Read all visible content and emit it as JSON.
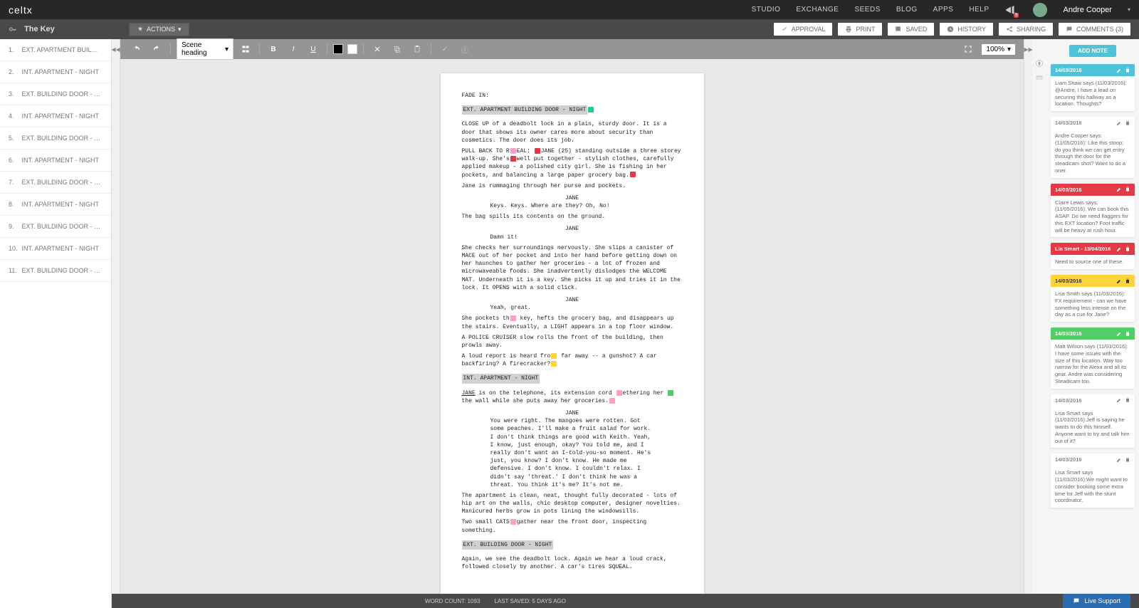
{
  "brand": "celtx",
  "topnav": [
    "STUDIO",
    "EXCHANGE",
    "SEEDS",
    "BLOG",
    "APPS",
    "HELP"
  ],
  "notif_count": "9",
  "user": "Andre Cooper",
  "project_title": "The Key",
  "actions_label": "ACTIONS",
  "subbar_buttons": {
    "approval": "APPROVAL",
    "print": "PRINT",
    "saved": "SAVED",
    "history": "HISTORY",
    "sharing": "SHARING",
    "comments": "COMMENTS (3)"
  },
  "scene_type_value": "Scene heading",
  "zoom_value": "100%",
  "scenes": [
    {
      "n": "1.",
      "t": "EXT. APARTMENT BUILDING DOOR - ..."
    },
    {
      "n": "2.",
      "t": "INT. APARTMENT - NIGHT"
    },
    {
      "n": "3.",
      "t": "EXT. BUILDING DOOR - NIGHT"
    },
    {
      "n": "4.",
      "t": "INT. APARTMENT - NIGHT"
    },
    {
      "n": "5.",
      "t": "EXT. BUILDING DOOR - NIGHT"
    },
    {
      "n": "6.",
      "t": "INT. APARTMENT - NIGHT"
    },
    {
      "n": "7.",
      "t": "EXT. BUILDING DOOR - NIGHT"
    },
    {
      "n": "8.",
      "t": "INT. APARTMENT - NIGHT"
    },
    {
      "n": "9.",
      "t": "EXT. BUILDING DOOR - NIGHT"
    },
    {
      "n": "10.",
      "t": "INT. APARTMENT - NIGHT"
    },
    {
      "n": "11.",
      "t": "EXT. BUILDING DOOR - NIGHT"
    }
  ],
  "script": {
    "fade_in": "FADE IN:",
    "sh1": "EXT. APARTMENT BUILDING DOOR - NIGHT",
    "a1": "CLOSE UP of a deadbolt lock in a plain, sturdy door. It is a door that shows its owner cares more about security than cosmetics. The door does its job.",
    "a2a": "PULL BACK TO R",
    "a2b": "EAL: ",
    "a2c": "JANE",
    "a2d": " (25) standing outside a three storey walk-up. She's",
    "a2e": "well put together - stylish clothes, carefully applied makeup - a polished city girl. She is fish",
    "a2f": "ing",
    "a2g": " in her pockets, and balancing a large paper grocery bag.",
    "a3": "Jane is rummaging through her purse and pockets.",
    "c1": "JANE",
    "d1": "Keys. Keys. Where are they? Oh, No!",
    "a4": "The bag spills its contents on the ground.",
    "c2": "JANE",
    "d2": "Damn it!",
    "a5": "She checks her surroundings nervously. She slips a canister of MACE out of her pocket and into her hand before getting down on her haunches to gather her groceries - a lot of frozen and microwaveable foods. She inadvertently dislodges the WELCOME MAT. Underneath it is a key. She picks it up and tries it in the lock. It OPENS with a solid click.",
    "c3": "JANE",
    "d3": "Yeah, great.",
    "a6a": "She pockets th",
    "a6b": " key, hefts the grocery bag, and disappears up the stairs.",
    "a6c": " Eventually, a LIGHT appears in a top floor window.",
    "a7": "A POLICE CRUISER slow rolls the front of the building, then prowls away.",
    "a8a": "A loud report is heard fro",
    "a8b": " far away -- a gunshot? A car backfiring? A firecracker?",
    "sh2": "INT. APARTMENT - NIGHT",
    "a9a": "JANE",
    "a9b": " is on the telephone, its extension cord ",
    "a9c": "ethering her ",
    "a9d": " the wall while she puts away her groceries.",
    "c4": "JANE",
    "d4": "You were right. The mangoes were rotten. Got some peaches. I'll make a fruit salad for work. I don't think things are good with Keith. Yeah, I know, just enough, okay? You told me, and I really don't want an I-told-you-so moment. He's just, you know? I don't know. He made me defensive. I don't know. I couldn't relax. I didn't say 'threat.' I don't think he was a threat. You think it's me? It's not me.",
    "a10": "The apartment is clean, neat, thought fully decorated - lots of hip art on the walls, chic desktop computer, designer novelties. Manicured herbs grow in pots lining the windowsills.",
    "a11a": "Two small CATS",
    "a11b": "gather near the front door, inspecting something.",
    "sh3": "EXT. BUILDING DOOR - NIGHT",
    "a12": "Again, we see the deadbolt lock. Again we hear a loud crack, followed closely by another.  A car's tires SQUEAL."
  },
  "add_note_label": "ADD NOTE",
  "notes": [
    {
      "date": "14/03/2016",
      "color": "blue",
      "body": "Liam Shaw says (11/03/2016): @Andre, I have a lead on securing this hallway as a location. Thoughts?"
    },
    {
      "date": "14/03/2016",
      "color": "gray",
      "body": "Andre Cooper says: (11/05/2016): Like this stoop; do you think we can get entry through the door for the steadicam shot? Want to do a oner."
    },
    {
      "date": "14/03/2016",
      "color": "red",
      "body": "Claire Lewis says: (11/05/2016): We can book this ASAP. Do we need flaggers for this EXT location? Foot traffic will be heavy at rush hour."
    },
    {
      "date": "Lia Smart - 13/04/2016",
      "color": "red",
      "body": "Need to source one of these."
    },
    {
      "date": "14/03/2016",
      "color": "yellow",
      "body": "Lisa Smith says (11/03/2016): FX requirement - can we have something less intense on the day as a cue for Jane?"
    },
    {
      "date": "14/03/2016",
      "color": "green",
      "body": "Matt Wilson says (11/03/2016): I have some issues with the size of this location. Way too narrow for the Alexa and all its gear. Andre was considering Steadicam too."
    },
    {
      "date": "14/03/2016",
      "color": "gray",
      "body": "Lisa Smart says (11/03/2016):Jeff is saying he wants to do this himself. Anyone want to try and talk him out of it?"
    },
    {
      "date": "14/03/2016",
      "color": "gray",
      "body": "Lisa Smart says (11/03/2016):We might want to consider booking some extra time for Jeff with the stunt coordinator."
    }
  ],
  "status": {
    "wordcount": "WORD COUNT: 1093",
    "lastsaved": "LAST SAVED: 5 DAYS AGO",
    "page": "?"
  },
  "live_support": "Live Support"
}
